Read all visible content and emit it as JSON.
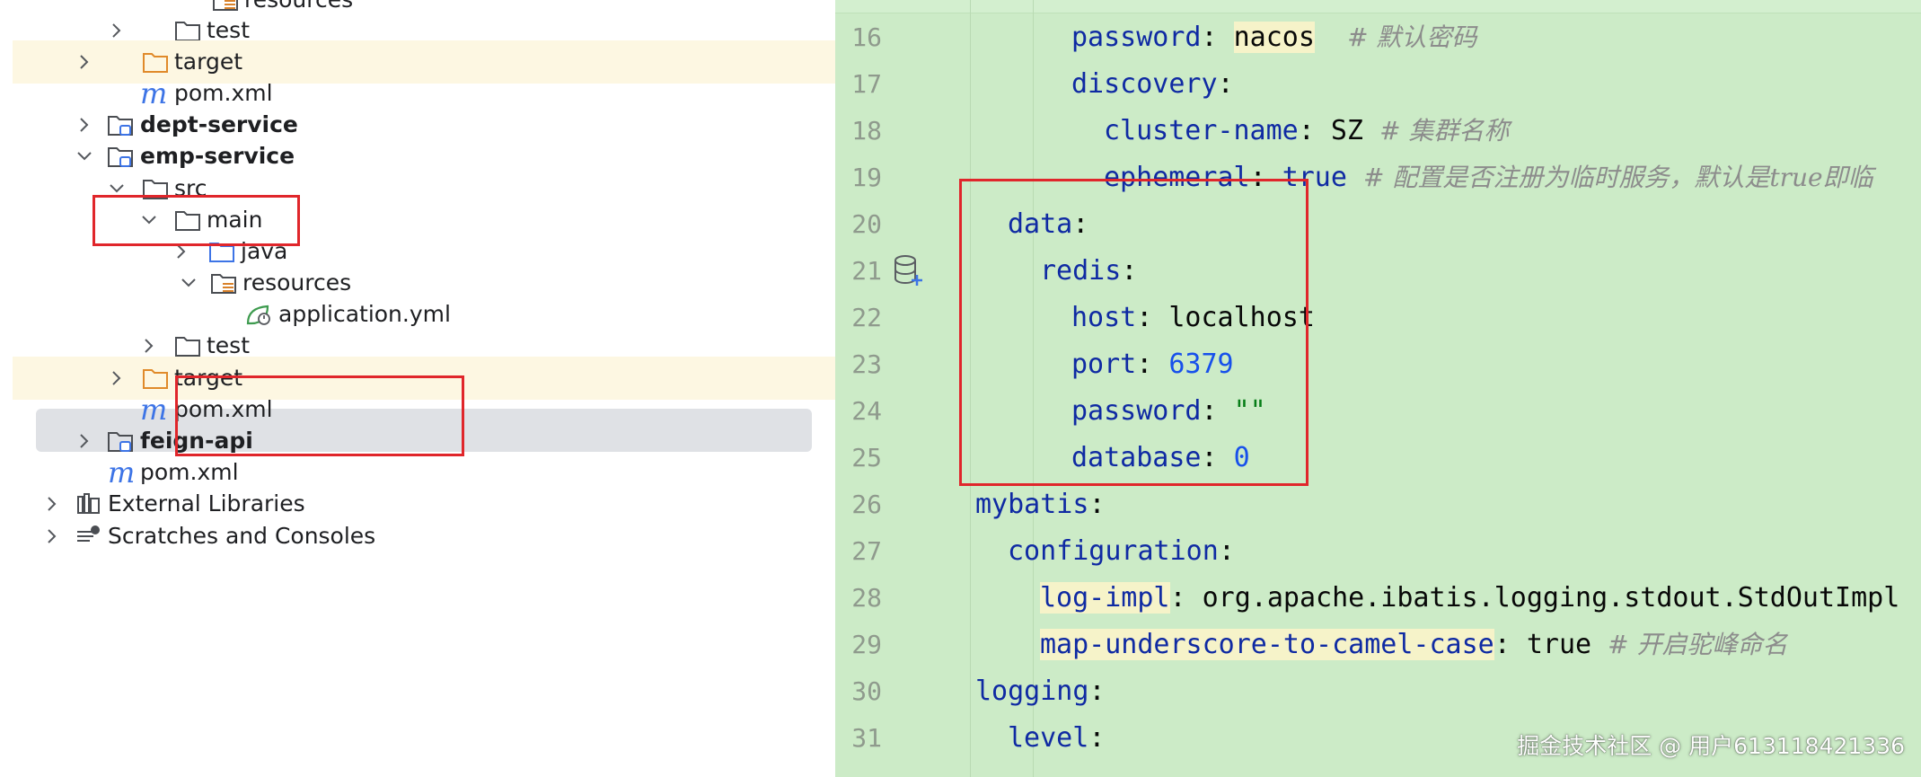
{
  "tree": {
    "top_partial": "resources",
    "items": [
      {
        "label": "test",
        "type": "folder",
        "chevron": "right"
      },
      {
        "label": "target",
        "type": "folder-excluded",
        "chevron": "right"
      },
      {
        "label": "pom.xml",
        "type": "maven"
      },
      {
        "label": "dept-service",
        "type": "module",
        "chevron": "right"
      },
      {
        "label": "emp-service",
        "type": "module",
        "chevron": "down"
      },
      {
        "label": "src",
        "type": "folder",
        "chevron": "down"
      },
      {
        "label": "main",
        "type": "folder",
        "chevron": "down"
      },
      {
        "label": "java",
        "type": "folder-source",
        "chevron": "right"
      },
      {
        "label": "resources",
        "type": "folder-resources",
        "chevron": "down"
      },
      {
        "label": "application.yml",
        "type": "spring-yml"
      },
      {
        "label": "test",
        "type": "folder",
        "chevron": "right"
      },
      {
        "label": "target",
        "type": "folder-excluded",
        "chevron": "right"
      },
      {
        "label": "pom.xml",
        "type": "maven"
      },
      {
        "label": "feign-api",
        "type": "module",
        "chevron": "right"
      },
      {
        "label": "pom.xml",
        "type": "maven"
      },
      {
        "label": "External Libraries",
        "type": "libraries",
        "chevron": "right"
      },
      {
        "label": "Scratches and Consoles",
        "type": "scratches",
        "chevron": "right"
      }
    ],
    "maven_letter": "m"
  },
  "editor": {
    "lines": [
      {
        "n": "16",
        "key": "password",
        "colon": ":",
        "val": "nacos",
        "comment": "# 默认密码"
      },
      {
        "n": "17",
        "key": "discovery",
        "colon": ":"
      },
      {
        "n": "18",
        "key": "cluster-name",
        "colon": ":",
        "val": "SZ",
        "comment": "# 集群名称"
      },
      {
        "n": "19",
        "key": "ephemeral",
        "colon": ":",
        "val": "true",
        "comment": "# 配置是否注册为临时服务，默认是true即临"
      },
      {
        "n": "20",
        "key": "data",
        "colon": ":"
      },
      {
        "n": "21",
        "key": "redis",
        "colon": ":"
      },
      {
        "n": "22",
        "key": "host",
        "colon": ":",
        "val": "localhost"
      },
      {
        "n": "23",
        "key": "port",
        "colon": ":",
        "val": "6379"
      },
      {
        "n": "24",
        "key": "password",
        "colon": ":",
        "val": "\"\""
      },
      {
        "n": "25",
        "key": "database",
        "colon": ":",
        "val": "0"
      },
      {
        "n": "26",
        "key": "mybatis",
        "colon": ":"
      },
      {
        "n": "27",
        "key": "configuration",
        "colon": ":"
      },
      {
        "n": "28",
        "key": "log-impl",
        "colon": ":",
        "val": "org.apache.ibatis.logging.stdout.StdOutImpl"
      },
      {
        "n": "29",
        "key": "map-underscore-to-camel-case",
        "colon": ":",
        "val": "true",
        "comment": "# 开启驼峰命名"
      },
      {
        "n": "30",
        "key": "logging",
        "colon": ":"
      },
      {
        "n": "31",
        "key": "level",
        "colon": ":"
      }
    ]
  },
  "watermark": "掘金技术社区 @ 用户613118421336",
  "colors": {
    "editor_bg": "#ccebc7",
    "key": "#0f2aa3",
    "number": "#1750eb",
    "string": "#067d17",
    "comment": "#8c8c8c",
    "annotation": "#e0262b",
    "excluded_row": "#fdf7e2",
    "selected_row": "#dfe1e5"
  }
}
